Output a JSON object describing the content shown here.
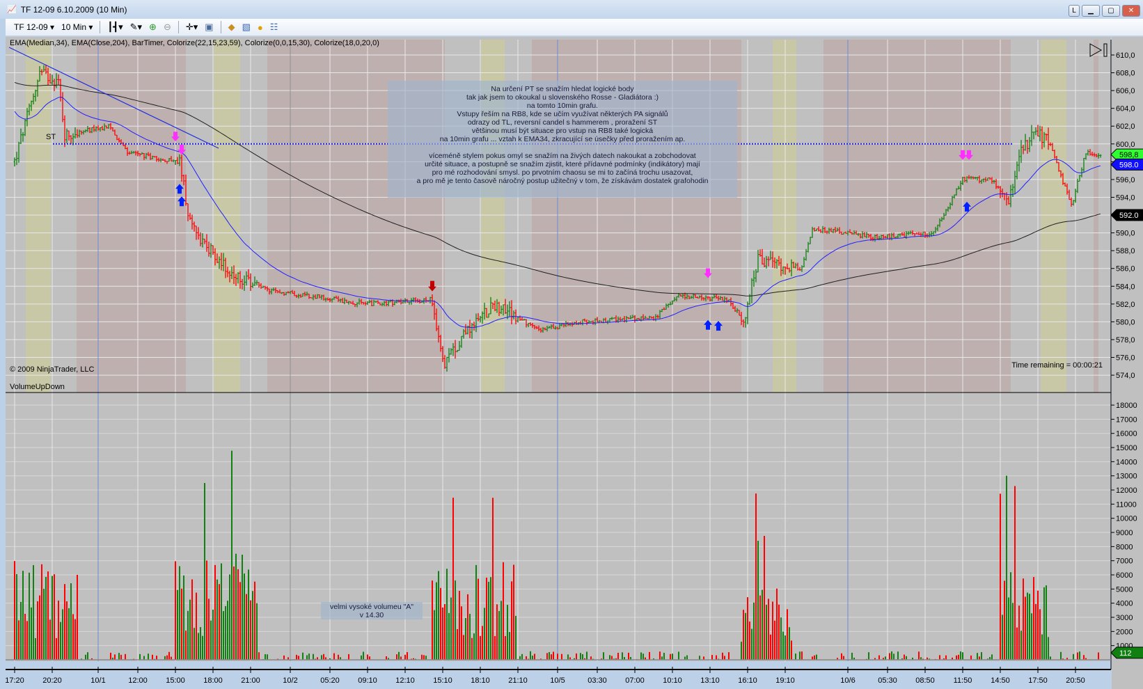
{
  "window": {
    "title": "TF 12-09  6.10.2009 (10 Min)",
    "btn_l": "L",
    "btn_min": "▁",
    "btn_max": "▢",
    "btn_close": "✕"
  },
  "toolbar": {
    "instrument": "TF 12-09",
    "interval": "10 Min"
  },
  "price_panel": {
    "indicators": "EMA(Median,34), EMA(Close,204), BarTimer, Colorize(22,15,23,59), Colorize(0,0,15,30), Colorize(18,0,20,0)",
    "copyright": "© 2009 NinjaTrader, LLC",
    "time_remaining": "Time remaining = 00:00:21",
    "st_label": "ST",
    "ticks": [
      "610,0",
      "608,0",
      "606,0",
      "604,0",
      "602,0",
      "600,0",
      "598,0",
      "596,0",
      "594,0",
      "592,0",
      "590,0",
      "588,0",
      "586,0",
      "584,0",
      "582,0",
      "580,0",
      "578,0",
      "576,0",
      "574,0"
    ],
    "last_price": "598,8",
    "ema34_value": "598.0",
    "ema204_value": "592.0",
    "note": "Na určení PT se snažím hledat logické body\ntak jak jsem to okoukal u slovenského Rosse - Gladiátora :)\nna tomto 10min grafu.\nVstupy řeším na RB8, kde se učím využívat některých PA signálů\nodrazy od TL, reversní candel s hammerem , proražení ST\nvětšinou musí být situace pro vstup na RB8 také logická\nna 10min grafu ... vztah k EMA34, zkracující se úsečky před proražením ap.\n\nvíceméně stylem pokus omyl se snažím na živých datech nakoukat a zobchodovat\nurčité situace, a postupně se snažím zjistit, které přídavné podmínky (indikátory) mají\npro mé rozhodování smysl. po prvotním chaosu se mi to začíná trochu usazovat,\na pro mě je tento časově náročný postup užitečný v tom, že získávám dostatek grafohodin",
    "price_keyframes": [
      [
        0,
        598
      ],
      [
        12,
        608
      ],
      [
        21,
        607
      ],
      [
        24,
        601
      ],
      [
        45,
        602
      ],
      [
        54,
        599
      ],
      [
        79,
        598
      ],
      [
        84,
        591
      ],
      [
        94,
        588
      ],
      [
        105,
        585
      ],
      [
        122,
        583.5
      ],
      [
        140,
        583
      ],
      [
        168,
        582
      ],
      [
        199,
        582.5
      ],
      [
        206,
        575
      ],
      [
        216,
        579
      ],
      [
        230,
        582
      ],
      [
        251,
        579
      ],
      [
        272,
        580
      ],
      [
        307,
        580.5
      ],
      [
        318,
        583
      ],
      [
        342,
        582.5
      ],
      [
        349,
        580
      ],
      [
        356,
        587
      ],
      [
        377,
        586
      ],
      [
        382,
        590.5
      ],
      [
        412,
        589.5
      ],
      [
        440,
        590
      ],
      [
        454,
        596
      ],
      [
        468,
        596
      ],
      [
        476,
        593.5
      ],
      [
        482,
        599
      ],
      [
        489,
        601.5
      ],
      [
        496,
        600
      ],
      [
        506,
        593
      ],
      [
        513,
        599
      ],
      [
        520,
        598.8
      ]
    ],
    "signals": [
      {
        "bar": 77,
        "type": "down"
      },
      {
        "bar": 80,
        "type": "down"
      },
      {
        "bar": 79,
        "type": "up"
      },
      {
        "bar": 80,
        "type": "up"
      },
      {
        "bar": 200,
        "type": "sell"
      },
      {
        "bar": 332,
        "type": "down"
      },
      {
        "bar": 332,
        "type": "up"
      },
      {
        "bar": 337,
        "type": "up"
      },
      {
        "bar": 457,
        "type": "down"
      },
      {
        "bar": 454,
        "type": "down"
      },
      {
        "bar": 456,
        "type": "up"
      }
    ]
  },
  "volume_panel": {
    "title": "VolumeUpDown",
    "ticks": [
      "18000",
      "17000",
      "16000",
      "15000",
      "14000",
      "13000",
      "12000",
      "11000",
      "10000",
      "9000",
      "8000",
      "7000",
      "6000",
      "5000",
      "4000",
      "3000",
      "2000",
      "1000"
    ],
    "last_volume": "112",
    "note": "velmi vysoké volumeu \"A\"\nv 14.30",
    "sessions": [
      [
        0,
        30,
        5000
      ],
      [
        77,
        116,
        5500
      ],
      [
        200,
        240,
        5000
      ],
      [
        348,
        372,
        4000
      ],
      [
        472,
        495,
        4500
      ]
    ]
  },
  "time_axis": [
    [
      "17:20",
      0
    ],
    [
      "20:20",
      18
    ],
    [
      "10/1",
      40
    ],
    [
      "12:00",
      59
    ],
    [
      "15:00",
      77
    ],
    [
      "18:00",
      95
    ],
    [
      "21:00",
      113
    ],
    [
      "10/2",
      132
    ],
    [
      "05:20",
      151
    ],
    [
      "09:10",
      169
    ],
    [
      "12:10",
      187
    ],
    [
      "15:10",
      205
    ],
    [
      "18:10",
      223
    ],
    [
      "21:10",
      241
    ],
    [
      "10/5",
      260
    ],
    [
      "03:30",
      279
    ],
    [
      "07:00",
      297
    ],
    [
      "10:10",
      315
    ],
    [
      "13:10",
      333
    ],
    [
      "16:10",
      351
    ],
    [
      "19:10",
      369
    ],
    [
      "10/6",
      399
    ],
    [
      "05:30",
      418
    ],
    [
      "08:50",
      436
    ],
    [
      "11:50",
      454
    ],
    [
      "14:50",
      472
    ],
    [
      "17:50",
      490
    ],
    [
      "20:50",
      508
    ]
  ],
  "colors": {
    "bg": "#c0c0c0",
    "pink": "#bfb0b0",
    "yellow": "#c8c8a6",
    "up": "#108010",
    "down": "#ff0000",
    "ema34": "#2020ff",
    "ema204": "#202020"
  }
}
